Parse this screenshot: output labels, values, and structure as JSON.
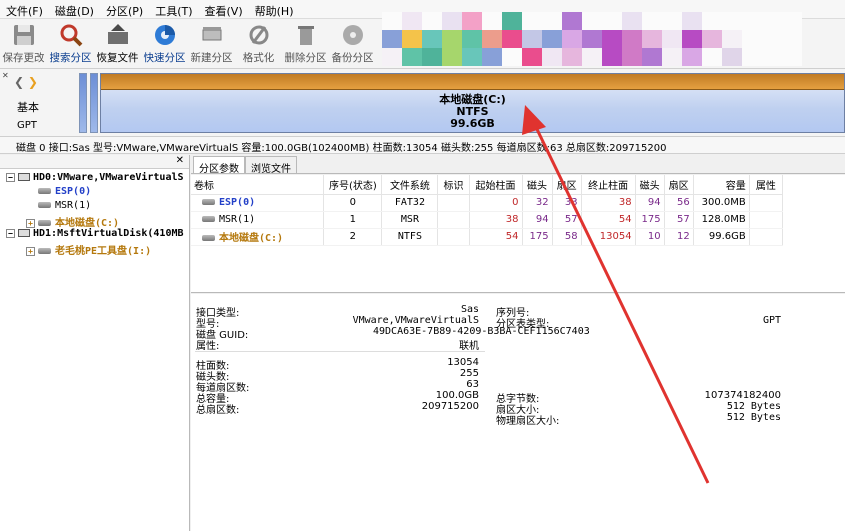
{
  "menu": [
    "文件(F)",
    "磁盘(D)",
    "分区(P)",
    "工具(T)",
    "查看(V)",
    "帮助(H)"
  ],
  "toolbar": [
    {
      "label": "保存更改",
      "icon": "save-icon"
    },
    {
      "label": "搜索分区",
      "icon": "search-partition-icon"
    },
    {
      "label": "恢复文件",
      "icon": "recover-files-icon"
    },
    {
      "label": "快速分区",
      "icon": "quick-partition-icon"
    },
    {
      "label": "新建分区",
      "icon": "new-partition-icon"
    },
    {
      "label": "格式化",
      "icon": "format-icon"
    },
    {
      "label": "删除分区",
      "icon": "delete-partition-icon"
    },
    {
      "label": "备份分区",
      "icon": "backup-partition-icon"
    }
  ],
  "diskmap": {
    "mode": "基本",
    "scheme": "GPT",
    "main_partition": {
      "name": "本地磁盘(C:)",
      "fs": "NTFS",
      "size": "99.6GB"
    }
  },
  "infostrip": "磁盘 0 接口:Sas  型号:VMware,VMwareVirtualS  容量:100.0GB(102400MB)  柱面数:13054  磁头数:255  每道扇区数:63  总扇区数:209715200",
  "tree": {
    "hd0": "HD0:VMware,VMwareVirtualS",
    "hd0_parts": [
      "ESP(0)",
      "MSR(1)",
      "本地磁盘(C:)"
    ],
    "hd1": "HD1:MsftVirtualDisk(410MB",
    "hd1_parts": [
      "老毛桃PE工具盘(I:)"
    ]
  },
  "tabs": [
    "分区参数",
    "浏览文件"
  ],
  "table": {
    "headers": [
      "卷标",
      "序号(状态)",
      "文件系统",
      "标识",
      "起始柱面",
      "磁头",
      "扇区",
      "终止柱面",
      "磁头",
      "扇区",
      "容量",
      "属性"
    ],
    "rows": [
      {
        "label": "ESP(0)",
        "seq": "0",
        "fs": "FAT32",
        "flag": "",
        "sc": "0",
        "sh": "32",
        "ss": "33",
        "ec": "38",
        "eh": "94",
        "es": "56",
        "cap": "300.0MB",
        "attr": ""
      },
      {
        "label": "MSR(1)",
        "seq": "1",
        "fs": "MSR",
        "flag": "",
        "sc": "38",
        "sh": "94",
        "ss": "57",
        "ec": "54",
        "eh": "175",
        "es": "57",
        "cap": "128.0MB",
        "attr": ""
      },
      {
        "label": "本地磁盘(C:)",
        "seq": "2",
        "fs": "NTFS",
        "flag": "",
        "sc": "54",
        "sh": "175",
        "ss": "58",
        "ec": "13054",
        "eh": "10",
        "es": "12",
        "cap": "99.6GB",
        "attr": ""
      }
    ]
  },
  "details": {
    "iface_label": "接口类型:",
    "iface_value": "Sas",
    "serial_label": "序列号:",
    "model_label": "型号:",
    "model_value": "VMware,VMwareVirtualS",
    "pt_label": "分区表类型:",
    "pt_value": "GPT",
    "guid_label": "磁盘 GUID:",
    "guid_value": "49DCA63E-7B89-4209-B3BA-CEF1156C7403",
    "attr_label": "属性:",
    "attr_value": "联机",
    "cyl_label": "柱面数:",
    "cyl_value": "13054",
    "heads_label": "磁头数:",
    "heads_value": "255",
    "spt_label": "每道扇区数:",
    "spt_value": "63",
    "cap_label": "总容量:",
    "cap_value": "100.0GB",
    "bytes_label": "总字节数:",
    "bytes_value": "107374182400",
    "sectors_label": "总扇区数:",
    "sectors_value": "209715200",
    "secsize_label": "扇区大小:",
    "secsize_value": "512 Bytes",
    "physsec_label": "物理扇区大小:",
    "physsec_value": "512 Bytes"
  },
  "colors": {
    "accent": "#2340c8",
    "partition_orange": "#b5790e",
    "arrow": "#e0332f"
  }
}
